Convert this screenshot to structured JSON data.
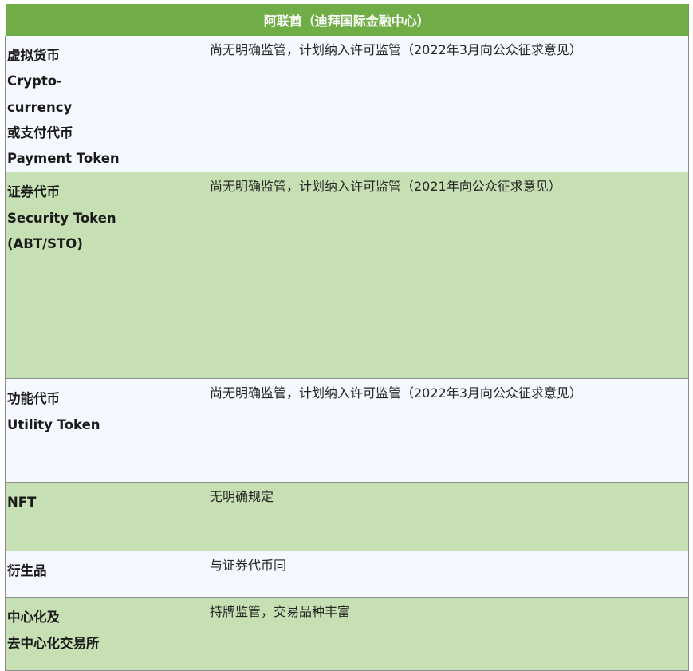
{
  "header": {
    "title": "阿联酋（迪拜国际金融中心）"
  },
  "colors": {
    "header_bg": "#70ad47",
    "row_white": "#f5f8fe",
    "row_green": "#c6e0b4"
  },
  "rows": [
    {
      "category_lines": [
        "虚拟货币",
        "Crypto-",
        "currency",
        "或支付代币",
        "Payment Token"
      ],
      "regulation": "尚无明确监管，计划纳入许可监管（2022年3月向公众征求意见）"
    },
    {
      "category_lines": [
        "证券代币",
        "Security Token",
        "(ABT/STO)"
      ],
      "regulation": "尚无明确监管，计划纳入许可监管（2021年向公众征求意见）"
    },
    {
      "category_lines": [
        "功能代币",
        "Utility Token"
      ],
      "regulation": "尚无明确监管，计划纳入许可监管（2022年3月向公众征求意见）"
    },
    {
      "category_lines": [
        "NFT"
      ],
      "regulation": "无明确规定"
    },
    {
      "category_lines": [
        "衍生品"
      ],
      "regulation": "与证券代币同"
    },
    {
      "category_lines": [
        "中心化及",
        "去中心化交易所"
      ],
      "regulation": "持牌监管，交易品种丰富"
    }
  ]
}
